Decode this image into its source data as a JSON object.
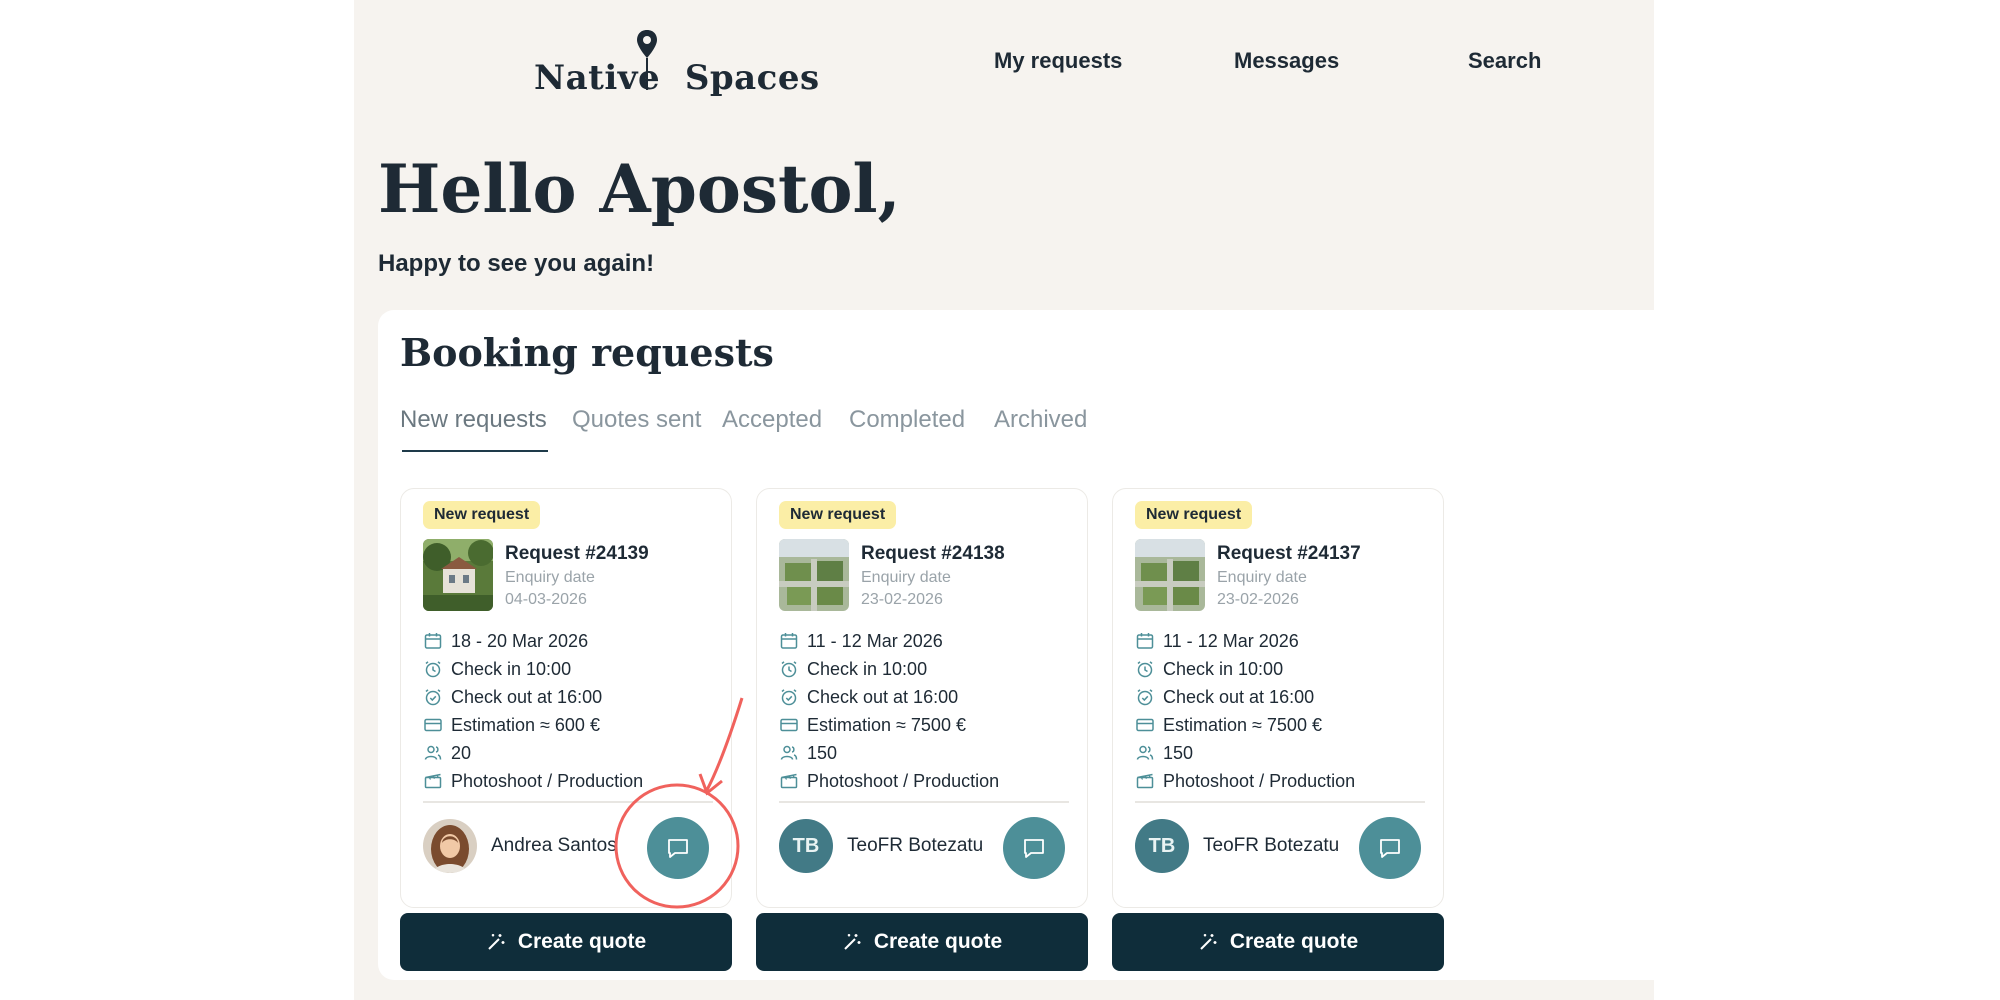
{
  "header": {
    "logo": {
      "word1": "Native",
      "word2": "Spaces"
    },
    "nav": [
      "My requests",
      "Messages",
      "Search"
    ]
  },
  "greeting": "Hello Apostol,",
  "subgreeting": "Happy to see you again!",
  "booking": {
    "title": "Booking requests",
    "tabs": [
      "New requests",
      "Quotes sent",
      "Accepted",
      "Completed",
      "Archived"
    ],
    "active_tab": "New requests",
    "cards": [
      {
        "badge": "New request",
        "title": "Request #24139",
        "enquiry_label": "Enquiry date",
        "enquiry_date": "04-03-2026",
        "dates": "18 - 20 Mar 2026",
        "check_in": "Check in 10:00",
        "check_out": "Check out at 16:00",
        "estimation": "Estimation ≈ 600 €",
        "guests": "20",
        "type": "Photoshoot / Production",
        "host": "Andrea Santos",
        "host_initials": "",
        "cta": "Create quote"
      },
      {
        "badge": "New request",
        "title": "Request #24138",
        "enquiry_label": "Enquiry date",
        "enquiry_date": "23-02-2026",
        "dates": "11 - 12 Mar 2026",
        "check_in": "Check in 10:00",
        "check_out": "Check out at 16:00",
        "estimation": "Estimation ≈ 7500 €",
        "guests": "150",
        "type": "Photoshoot / Production",
        "host": "TeoFR Botezatu",
        "host_initials": "TB",
        "cta": "Create quote"
      },
      {
        "badge": "New request",
        "title": "Request #24137",
        "enquiry_label": "Enquiry date",
        "enquiry_date": "23-02-2026",
        "dates": "11 - 12 Mar 2026",
        "check_in": "Check in 10:00",
        "check_out": "Check out at 16:00",
        "estimation": "Estimation ≈ 7500 €",
        "guests": "150",
        "type": "Photoshoot / Production",
        "host": "TeoFR Botezatu",
        "host_initials": "TB",
        "cta": "Create quote"
      }
    ]
  },
  "icons": {
    "dates": "calendar-icon",
    "check_in": "alarm-clock-icon",
    "check_out": "alarm-clock-check-icon",
    "estimation": "credit-card-icon",
    "guests": "people-icon",
    "type": "clapperboard-icon",
    "chat": "chat-bubble-icon",
    "cta": "magic-wand-icon"
  },
  "colors": {
    "page_bg": "#f6f3ef",
    "text_dark": "#1e2a35",
    "badge_bg": "#fbeea6",
    "chat_button": "#4d8f98",
    "cta_bg": "#0f2d3a",
    "annotation": "#f0625d"
  }
}
